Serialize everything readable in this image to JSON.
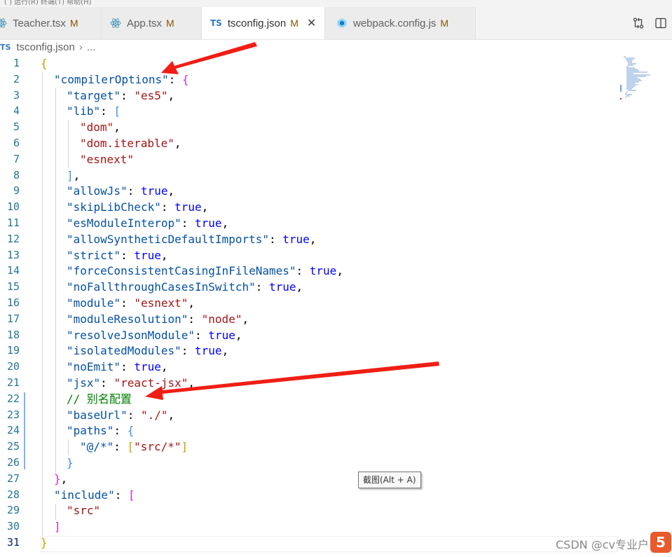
{
  "menu_strip": "( )   运行(R)   终端(T)   帮助(H)",
  "tabs": [
    {
      "label": "Teacher.tsx",
      "status": "M",
      "icon": "react-icon"
    },
    {
      "label": "App.tsx",
      "status": "M",
      "icon": "react-icon"
    },
    {
      "label": "tsconfig.json",
      "status": "M",
      "icon": "ts-icon",
      "active": true
    },
    {
      "label": "webpack.config.js",
      "status": "M",
      "icon": "webpack-icon"
    }
  ],
  "ts_badge": "TS",
  "close_glyph": "✕",
  "breadcrumb": {
    "file": "tsconfig.json",
    "sep": "›",
    "more": "..."
  },
  "lines": [
    {
      "n": "1",
      "t": [
        [
          "br1",
          "{"
        ]
      ]
    },
    {
      "n": "2",
      "t": [
        [
          "k",
          "\"compilerOptions\""
        ],
        [
          "p",
          ": "
        ],
        [
          "br2",
          "{"
        ]
      ]
    },
    {
      "n": "3",
      "t": [
        [
          "k",
          "\"target\""
        ],
        [
          "p",
          ": "
        ],
        [
          "s",
          "\"es5\""
        ],
        [
          "p",
          ","
        ]
      ]
    },
    {
      "n": "4",
      "t": [
        [
          "k",
          "\"lib\""
        ],
        [
          "p",
          ": "
        ],
        [
          "br3",
          "["
        ]
      ]
    },
    {
      "n": "5",
      "t": [
        [
          "s",
          "\"dom\""
        ],
        [
          "p",
          ","
        ]
      ]
    },
    {
      "n": "6",
      "t": [
        [
          "s",
          "\"dom.iterable\""
        ],
        [
          "p",
          ","
        ]
      ]
    },
    {
      "n": "7",
      "t": [
        [
          "s",
          "\"esnext\""
        ]
      ]
    },
    {
      "n": "8",
      "t": [
        [
          "br3",
          "]"
        ],
        [
          "p",
          ","
        ]
      ]
    },
    {
      "n": "9",
      "t": [
        [
          "k",
          "\"allowJs\""
        ],
        [
          "p",
          ": "
        ],
        [
          "b",
          "true"
        ],
        [
          "p",
          ","
        ]
      ]
    },
    {
      "n": "10",
      "t": [
        [
          "k",
          "\"skipLibCheck\""
        ],
        [
          "p",
          ": "
        ],
        [
          "b",
          "true"
        ],
        [
          "p",
          ","
        ]
      ]
    },
    {
      "n": "11",
      "t": [
        [
          "k",
          "\"esModuleInterop\""
        ],
        [
          "p",
          ": "
        ],
        [
          "b",
          "true"
        ],
        [
          "p",
          ","
        ]
      ]
    },
    {
      "n": "12",
      "t": [
        [
          "k",
          "\"allowSyntheticDefaultImports\""
        ],
        [
          "p",
          ": "
        ],
        [
          "b",
          "true"
        ],
        [
          "p",
          ","
        ]
      ]
    },
    {
      "n": "13",
      "t": [
        [
          "k",
          "\"strict\""
        ],
        [
          "p",
          ": "
        ],
        [
          "b",
          "true"
        ],
        [
          "p",
          ","
        ]
      ]
    },
    {
      "n": "14",
      "t": [
        [
          "k",
          "\"forceConsistentCasingInFileNames\""
        ],
        [
          "p",
          ": "
        ],
        [
          "b",
          "true"
        ],
        [
          "p",
          ","
        ]
      ]
    },
    {
      "n": "15",
      "t": [
        [
          "k",
          "\"noFallthroughCasesInSwitch\""
        ],
        [
          "p",
          ": "
        ],
        [
          "b",
          "true"
        ],
        [
          "p",
          ","
        ]
      ]
    },
    {
      "n": "16",
      "t": [
        [
          "k",
          "\"module\""
        ],
        [
          "p",
          ": "
        ],
        [
          "s",
          "\"esnext\""
        ],
        [
          "p",
          ","
        ]
      ]
    },
    {
      "n": "17",
      "t": [
        [
          "k",
          "\"moduleResolution\""
        ],
        [
          "p",
          ": "
        ],
        [
          "s",
          "\"node\""
        ],
        [
          "p",
          ","
        ]
      ]
    },
    {
      "n": "18",
      "t": [
        [
          "k",
          "\"resolveJsonModule\""
        ],
        [
          "p",
          ": "
        ],
        [
          "b",
          "true"
        ],
        [
          "p",
          ","
        ]
      ]
    },
    {
      "n": "19",
      "t": [
        [
          "k",
          "\"isolatedModules\""
        ],
        [
          "p",
          ": "
        ],
        [
          "b",
          "true"
        ],
        [
          "p",
          ","
        ]
      ]
    },
    {
      "n": "20",
      "t": [
        [
          "k",
          "\"noEmit\""
        ],
        [
          "p",
          ": "
        ],
        [
          "b",
          "true"
        ],
        [
          "p",
          ","
        ]
      ]
    },
    {
      "n": "21",
      "t": [
        [
          "k",
          "\"jsx\""
        ],
        [
          "p",
          ": "
        ],
        [
          "s",
          "\"react-jsx\""
        ],
        [
          "p",
          ","
        ]
      ]
    },
    {
      "n": "22",
      "t": [
        [
          "c",
          "// 别名配置"
        ]
      ]
    },
    {
      "n": "23",
      "t": [
        [
          "k",
          "\"baseUrl\""
        ],
        [
          "p",
          ": "
        ],
        [
          "s",
          "\"./\""
        ],
        [
          "p",
          ","
        ]
      ]
    },
    {
      "n": "24",
      "t": [
        [
          "k",
          "\"paths\""
        ],
        [
          "p",
          ": "
        ],
        [
          "br3",
          "{"
        ]
      ]
    },
    {
      "n": "25",
      "t": [
        [
          "k",
          "\"@/*\""
        ],
        [
          "p",
          ": "
        ],
        [
          "br1",
          "["
        ],
        [
          "s",
          "\"src/*\""
        ],
        [
          "br1",
          "]"
        ]
      ]
    },
    {
      "n": "26",
      "t": [
        [
          "br3",
          "}"
        ]
      ]
    },
    {
      "n": "27",
      "t": [
        [
          "br2",
          "}"
        ],
        [
          "p",
          ","
        ]
      ]
    },
    {
      "n": "28",
      "t": [
        [
          "k",
          "\"include\""
        ],
        [
          "p",
          ": "
        ],
        [
          "br2",
          "["
        ]
      ]
    },
    {
      "n": "29",
      "t": [
        [
          "s",
          "\"src\""
        ]
      ]
    },
    {
      "n": "30",
      "t": [
        [
          "br2",
          "]"
        ]
      ]
    },
    {
      "n": "31",
      "t": [
        [
          "br1",
          "}"
        ]
      ]
    }
  ],
  "tooltip": "截图(Alt + A)",
  "watermark": "CSDN @cv专业户",
  "watermark_logo": "5",
  "colors": {
    "key": "#0451a5",
    "string": "#a31515",
    "keyword": "#0000ff",
    "comment": "#008000",
    "arrow": "#f01e14",
    "line_number": "#237893"
  }
}
